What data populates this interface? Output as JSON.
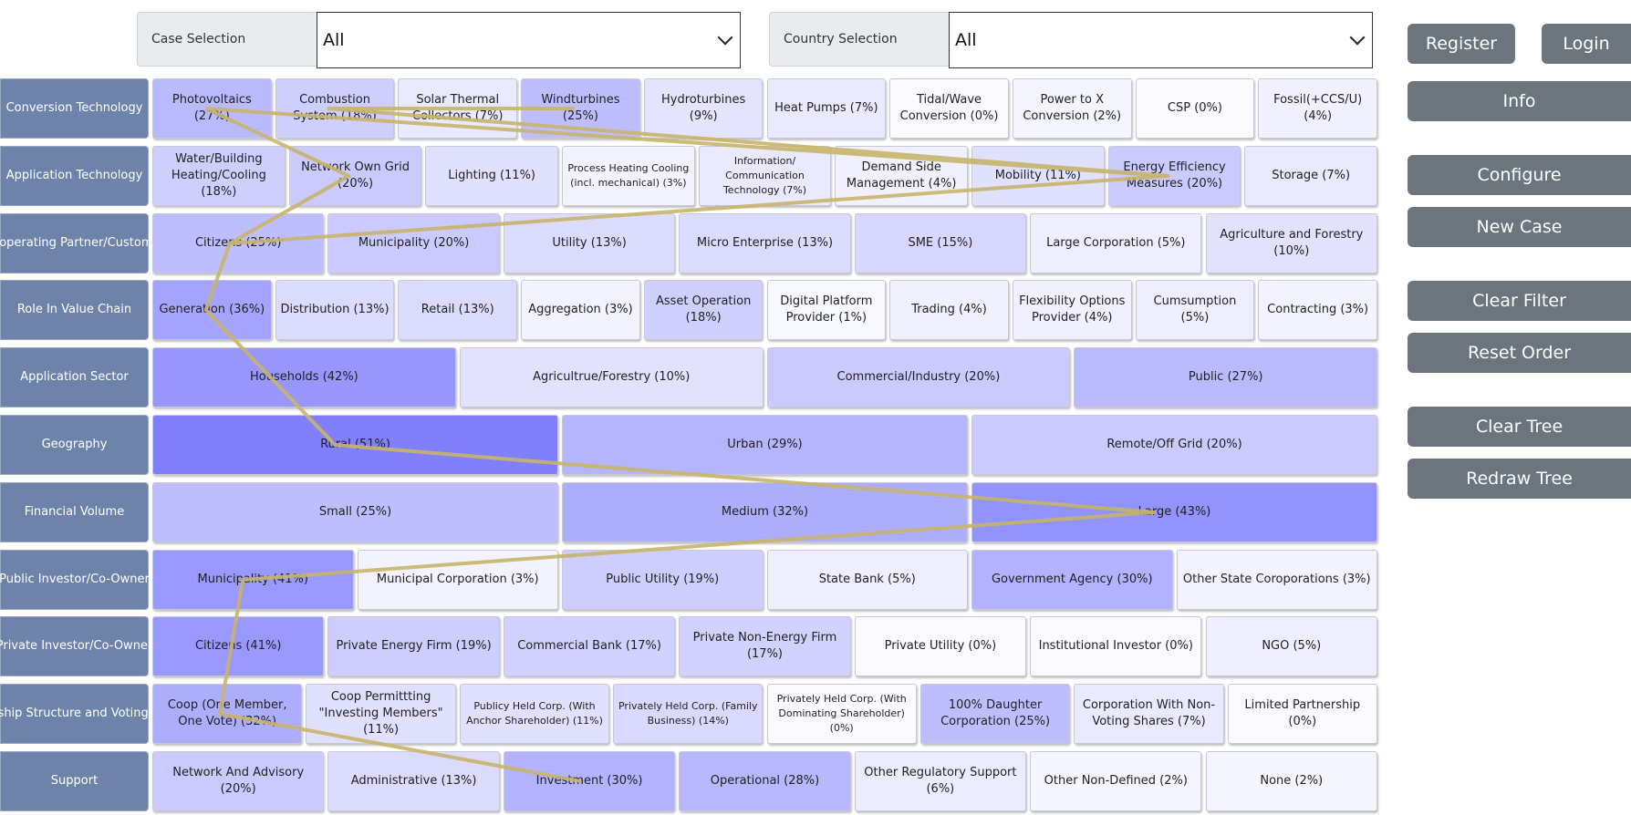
{
  "case_selection": {
    "label": "Case Selection",
    "value": "All"
  },
  "country_selection": {
    "label": "Country Selection",
    "value": "All"
  },
  "buttons": {
    "register": "Register",
    "login": "Login",
    "info": "Info",
    "configure": "Configure",
    "new_case": "New Case",
    "clear_filter": "Clear Filter",
    "reset_order": "Reset Order",
    "clear_tree": "Clear Tree",
    "redraw_tree": "Redraw Tree"
  },
  "rows": [
    {
      "label": "Conversion Technology",
      "cells": [
        {
          "text": "Photovoltaics (27%)",
          "pct": 27
        },
        {
          "text": "Combustion System (18%)",
          "pct": 18
        },
        {
          "text": "Solar Thermal Collectors (7%)",
          "pct": 7
        },
        {
          "text": "Windturbines (25%)",
          "pct": 25
        },
        {
          "text": "Hydroturbines (9%)",
          "pct": 9
        },
        {
          "text": "Heat Pumps (7%)",
          "pct": 7
        },
        {
          "text": "Tidal/Wave Conversion (0%)",
          "pct": 0
        },
        {
          "text": "Power to X Conversion (2%)",
          "pct": 2
        },
        {
          "text": "CSP (0%)",
          "pct": 0
        },
        {
          "text": "Fossil(+CCS/U) (4%)",
          "pct": 4
        }
      ]
    },
    {
      "label": "Application Technology",
      "cells": [
        {
          "text": "Water/Building Heating/Cooling (18%)",
          "pct": 18
        },
        {
          "text": "Network Own Grid (20%)",
          "pct": 20
        },
        {
          "text": "Lighting (11%)",
          "pct": 11
        },
        {
          "text": "Process Heating Cooling (incl. mechanical) (3%)",
          "pct": 3,
          "small": true
        },
        {
          "text": "Information/ Communication Technology (7%)",
          "pct": 7,
          "small": true
        },
        {
          "text": "Demand Side Management (4%)",
          "pct": 4
        },
        {
          "text": "Mobility (11%)",
          "pct": 11
        },
        {
          "text": "Energy Efficiency Measures (20%)",
          "pct": 20
        },
        {
          "text": "Storage (7%)",
          "pct": 7
        }
      ]
    },
    {
      "label": "Cooperating Partner/Customer",
      "cells": [
        {
          "text": "Citizens (25%)",
          "pct": 25
        },
        {
          "text": "Municipality (20%)",
          "pct": 20
        },
        {
          "text": "Utility (13%)",
          "pct": 13
        },
        {
          "text": "Micro Enterprise (13%)",
          "pct": 13
        },
        {
          "text": "SME (15%)",
          "pct": 15
        },
        {
          "text": "Large Corporation (5%)",
          "pct": 5
        },
        {
          "text": "Agriculture and Forestry (10%)",
          "pct": 10
        }
      ]
    },
    {
      "label": "Role In Value Chain",
      "cells": [
        {
          "text": "Generation (36%)",
          "pct": 36
        },
        {
          "text": "Distribution (13%)",
          "pct": 13
        },
        {
          "text": "Retail (13%)",
          "pct": 13
        },
        {
          "text": "Aggregation (3%)",
          "pct": 3
        },
        {
          "text": "Asset Operation (18%)",
          "pct": 18
        },
        {
          "text": "Digital Platform Provider (1%)",
          "pct": 1
        },
        {
          "text": "Trading (4%)",
          "pct": 4
        },
        {
          "text": "Flexibility Options Provider (4%)",
          "pct": 4
        },
        {
          "text": "Cumsumption (5%)",
          "pct": 5
        },
        {
          "text": "Contracting (3%)",
          "pct": 3
        }
      ]
    },
    {
      "label": "Application Sector",
      "cells": [
        {
          "text": "Households (42%)",
          "pct": 42
        },
        {
          "text": "Agricultrue/Forestry (10%)",
          "pct": 10
        },
        {
          "text": "Commercial/Industry (20%)",
          "pct": 20
        },
        {
          "text": "Public (27%)",
          "pct": 27
        }
      ]
    },
    {
      "label": "Geography",
      "cells": [
        {
          "text": "Rural (51%)",
          "pct": 51
        },
        {
          "text": "Urban (29%)",
          "pct": 29
        },
        {
          "text": "Remote/Off Grid (20%)",
          "pct": 20
        }
      ]
    },
    {
      "label": "Financial Volume",
      "cells": [
        {
          "text": "Small (25%)",
          "pct": 25
        },
        {
          "text": "Medium (32%)",
          "pct": 32
        },
        {
          "text": "Large (43%)",
          "pct": 43
        }
      ]
    },
    {
      "label": "Public Investor/Co-Owner",
      "cells": [
        {
          "text": "Municipality (41%)",
          "pct": 41
        },
        {
          "text": "Municipal Corporation (3%)",
          "pct": 3
        },
        {
          "text": "Public Utility (19%)",
          "pct": 19
        },
        {
          "text": "State Bank (5%)",
          "pct": 5
        },
        {
          "text": "Government Agency (30%)",
          "pct": 30
        },
        {
          "text": "Other State Coroporations (3%)",
          "pct": 3
        }
      ]
    },
    {
      "label": "Private Investor/Co-Owner",
      "cells": [
        {
          "text": "Citizens (41%)",
          "pct": 41
        },
        {
          "text": "Private Energy Firm (19%)",
          "pct": 19
        },
        {
          "text": "Commercial Bank (17%)",
          "pct": 17
        },
        {
          "text": "Private Non-Energy Firm (17%)",
          "pct": 17
        },
        {
          "text": "Private Utility (0%)",
          "pct": 0
        },
        {
          "text": "Institutional Investor (0%)",
          "pct": 0
        },
        {
          "text": "NGO (5%)",
          "pct": 5
        }
      ]
    },
    {
      "label": "Ownership Structure and Voting Rights",
      "cells": [
        {
          "text": "Coop (One Member, One Vote) (32%)",
          "pct": 32
        },
        {
          "text": "Coop Permittting \"Investing Members\" (11%)",
          "pct": 11
        },
        {
          "text": "Publicy Held Corp. (With Anchor Shareholder) (11%)",
          "pct": 11,
          "small": true
        },
        {
          "text": "Privately Held Corp. (Family Business) (14%)",
          "pct": 14,
          "small": true
        },
        {
          "text": "Privately Held Corp. (With Dominating Shareholder) (0%)",
          "pct": 0,
          "small": true
        },
        {
          "text": "100% Daughter Corporation (25%)",
          "pct": 25
        },
        {
          "text": "Corporation With Non-Voting Shares (7%)",
          "pct": 7
        },
        {
          "text": "Limited Partnership (0%)",
          "pct": 0
        }
      ]
    },
    {
      "label": "Support",
      "cells": [
        {
          "text": "Network And Advisory (20%)",
          "pct": 20
        },
        {
          "text": "Administrative (13%)",
          "pct": 13
        },
        {
          "text": "Investment (30%)",
          "pct": 30
        },
        {
          "text": "Operational (28%)",
          "pct": 28
        },
        {
          "text": "Other Regulatory Support (6%)",
          "pct": 6
        },
        {
          "text": "Other Non-Defined (2%)",
          "pct": 2
        },
        {
          "text": "None (2%)",
          "pct": 2
        }
      ]
    }
  ],
  "tree_color": "#c8b46a",
  "tree_paths": [
    [
      [
        0,
        0
      ],
      [
        1,
        7
      ],
      [
        0,
        1
      ],
      [
        0,
        3
      ]
    ],
    [
      [
        0,
        0
      ],
      [
        1,
        1
      ],
      [
        2,
        0
      ],
      [
        1,
        7
      ]
    ],
    [
      [
        2,
        0
      ],
      [
        3,
        0
      ],
      [
        5,
        0
      ],
      [
        6,
        2
      ],
      [
        7,
        0
      ],
      [
        9,
        0
      ],
      [
        10,
        2
      ]
    ]
  ]
}
